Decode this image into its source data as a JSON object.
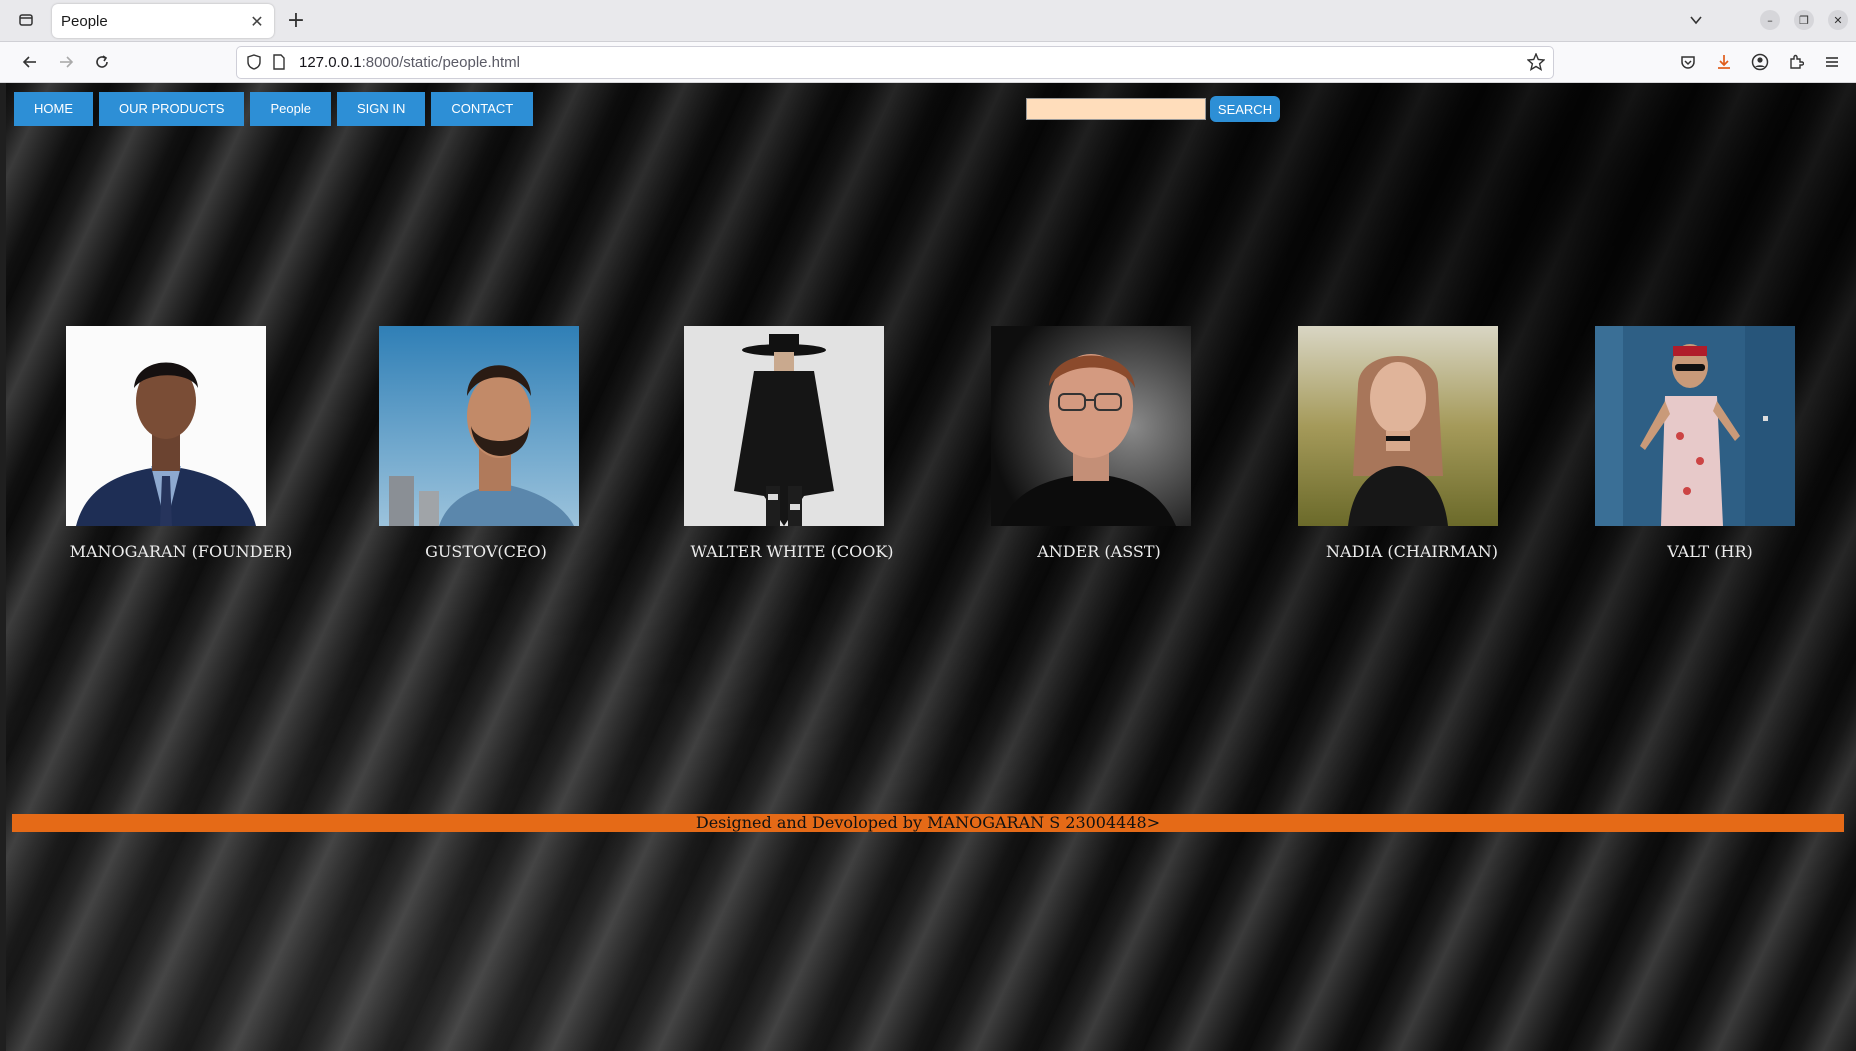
{
  "browser": {
    "tab_title": "People",
    "url_host": "127.0.0.1",
    "url_rest": ":8000/static/people.html"
  },
  "nav": {
    "items": [
      "HOME",
      "OUR PRODUCTS",
      "People",
      "SIGN IN",
      "CONTACT"
    ],
    "search_value": "",
    "search_button": "SEARCH"
  },
  "people": [
    {
      "caption": "MANOGARAN (FOUNDER)"
    },
    {
      "caption": "GUSTOV(CEO)"
    },
    {
      "caption": "WALTER WHITE (COOK)"
    },
    {
      "caption": "ANDER (ASST)"
    },
    {
      "caption": "NADIA (CHAIRMAN)"
    },
    {
      "caption": "VALT (HR)"
    }
  ],
  "footer": {
    "text": "Designed and Devoloped by MANOGARAN S 23004448>"
  },
  "colors": {
    "menu_blue": "#2d8fd6",
    "footer_orange": "#e56a17",
    "search_fill": "#ffddbb"
  }
}
